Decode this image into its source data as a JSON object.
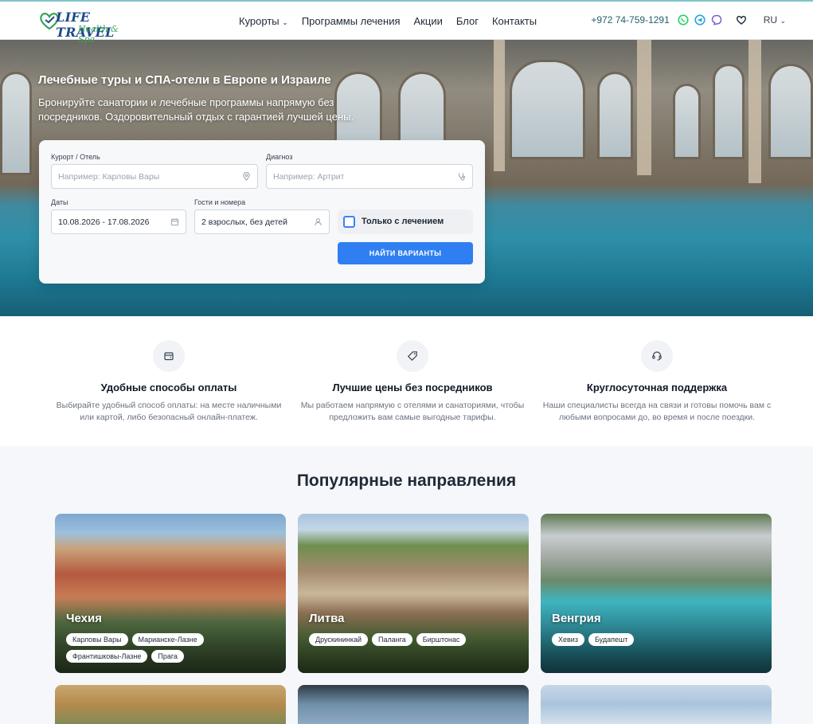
{
  "header": {
    "logo_main": "LIFE TRAVEL",
    "logo_sub": "Health & Spa",
    "nav": [
      {
        "label": "Курорты",
        "has_dropdown": true
      },
      {
        "label": "Программы лечения"
      },
      {
        "label": "Акции"
      },
      {
        "label": "Блог"
      },
      {
        "label": "Контакты"
      }
    ],
    "phone": "+972 74-759-1291",
    "lang": "RU"
  },
  "hero": {
    "title": "Лечебные туры и СПА-отели в Европе и Израиле",
    "subtitle": "Бронируйте санатории и лечебные программы напрямую без посредников. Оздоровительный отдых с гарантией лучшей цены."
  },
  "search": {
    "resort_label": "Курорт / Отель",
    "resort_placeholder": "Например: Карловы Вары",
    "diagnosis_label": "Диагноз",
    "diagnosis_placeholder": "Например: Артрит",
    "dates_label": "Даты",
    "dates_value": "10.08.2026 - 17.08.2026",
    "guests_label": "Гости и номера",
    "guests_value": "2 взрослых, без детей",
    "treatment_only_label": "Только с лечением",
    "find_button": "НАЙТИ ВАРИАНТЫ"
  },
  "features": [
    {
      "icon": "wallet-icon",
      "title": "Удобные способы оплаты",
      "desc": "Выбирайте удобный способ оплаты: на месте наличными или картой, либо безопасный онлайн-платеж."
    },
    {
      "icon": "tag-icon",
      "title": "Лучшие цены без посредников",
      "desc": "Мы работаем напрямую с отелями и санаториями, чтобы предложить вам самые выгодные тарифы."
    },
    {
      "icon": "headset-icon",
      "title": "Круглосуточная поддержка",
      "desc": "Наши специалисты всегда на связи и готовы помочь вам с любыми вопросами до, во время и после поездки."
    }
  ],
  "destinations": {
    "title": "Популярные направления",
    "cards": [
      {
        "name": "Чехия",
        "tags": [
          "Карловы Вары",
          "Марианске-Лазне",
          "Франтишковы-Лазне",
          "Прага"
        ]
      },
      {
        "name": "Литва",
        "tags": [
          "Друскининкай",
          "Паланга",
          "Бирштонас"
        ]
      },
      {
        "name": "Венгрия",
        "tags": [
          "Хевиз",
          "Будапешт"
        ]
      }
    ]
  },
  "colors": {
    "accent": "#2f7ff2",
    "whatsapp": "#25d366",
    "telegram": "#2aa3df",
    "viber": "#7c5cd6"
  }
}
